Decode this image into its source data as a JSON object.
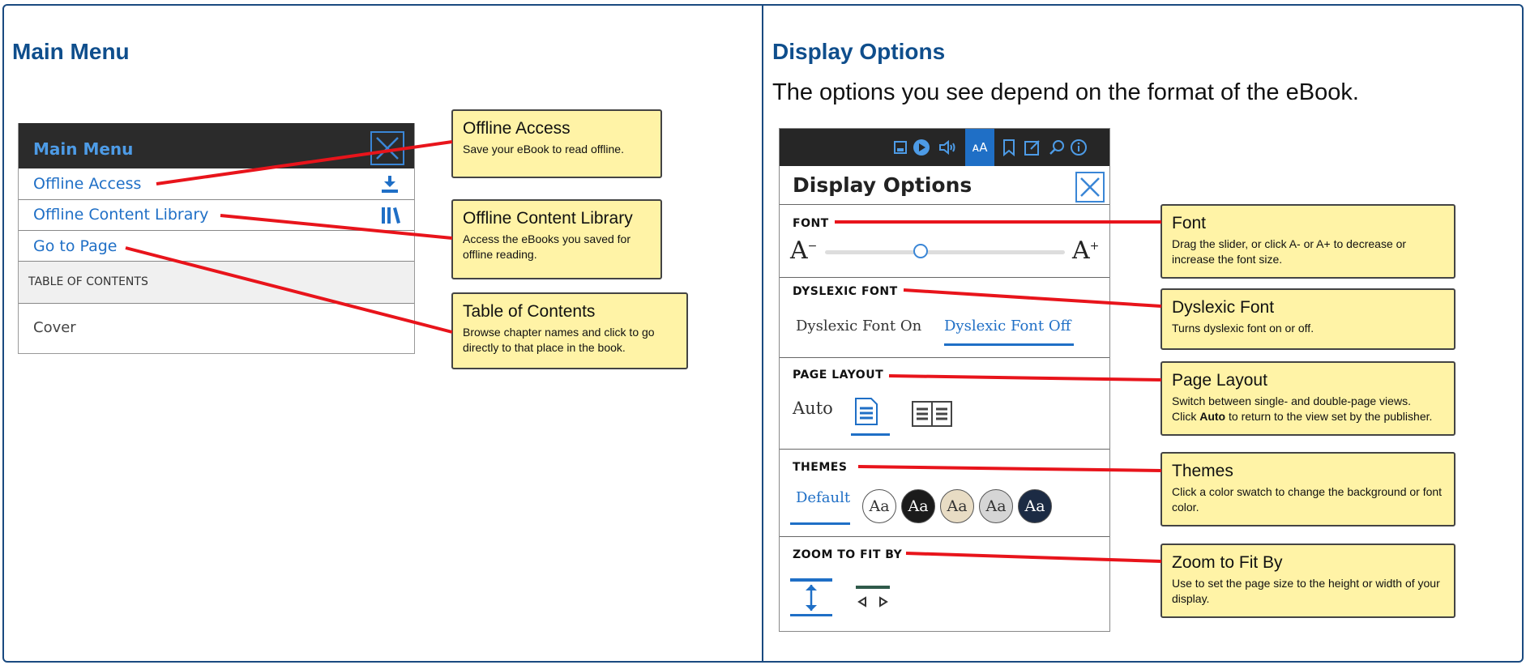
{
  "left": {
    "heading": "Main Menu",
    "menu": {
      "title": "Main Menu",
      "items": [
        {
          "label": "Offline Access",
          "icon": "download-icon"
        },
        {
          "label": "Offline Content Library",
          "icon": "library-icon"
        },
        {
          "label": "Go to Page"
        }
      ],
      "toc_label": "TABLE OF CONTENTS",
      "toc_items": [
        "Cover"
      ]
    },
    "callouts": [
      {
        "title": "Offline Access",
        "desc": "Save your eBook to read offline."
      },
      {
        "title": "Offline Content Library",
        "desc": "Access the eBooks you saved for offline reading."
      },
      {
        "title": "Table of Contents",
        "desc": "Browse chapter names and click to go directly to that place in the book."
      }
    ]
  },
  "right": {
    "heading": "Display Options",
    "subtext": "The options you see depend on the format of the eBook.",
    "panel": {
      "title": "Display Options",
      "font_label": "FONT",
      "font_decrease": "A",
      "font_increase": "A",
      "font_slider_value": 0.4,
      "dyslexic_label": "DYSLEXIC FONT",
      "dyslexic_on": "Dyslexic Font On",
      "dyslexic_off": "Dyslexic Font Off",
      "layout_label": "PAGE LAYOUT",
      "layout_auto": "Auto",
      "themes_label": "THEMES",
      "themes_default": "Default",
      "swatch_text": "Aa",
      "swatches": [
        "#ffffff",
        "#1b1b1b",
        "#e8dcc4",
        "#d5d5d5",
        "#1c2b44"
      ],
      "zoom_label": "ZOOM TO FIT BY",
      "accent": "#1f6fc6"
    },
    "callouts": [
      {
        "title": "Font",
        "desc": "Drag the slider, or click A- or A+ to decrease or increase the font size."
      },
      {
        "title": "Dyslexic Font",
        "desc": "Turns dyslexic font on or off."
      },
      {
        "title": "Page Layout",
        "desc1": "Switch between single- and double-page views.",
        "desc2_pre": "Click ",
        "desc2_bold": "Auto",
        "desc2_post": " to return to the view set by the publisher."
      },
      {
        "title": "Themes",
        "desc": "Click a color swatch to change the background or font color."
      },
      {
        "title": "Zoom to Fit By",
        "desc": "Use to set the page size to the height or width of your display."
      }
    ]
  }
}
